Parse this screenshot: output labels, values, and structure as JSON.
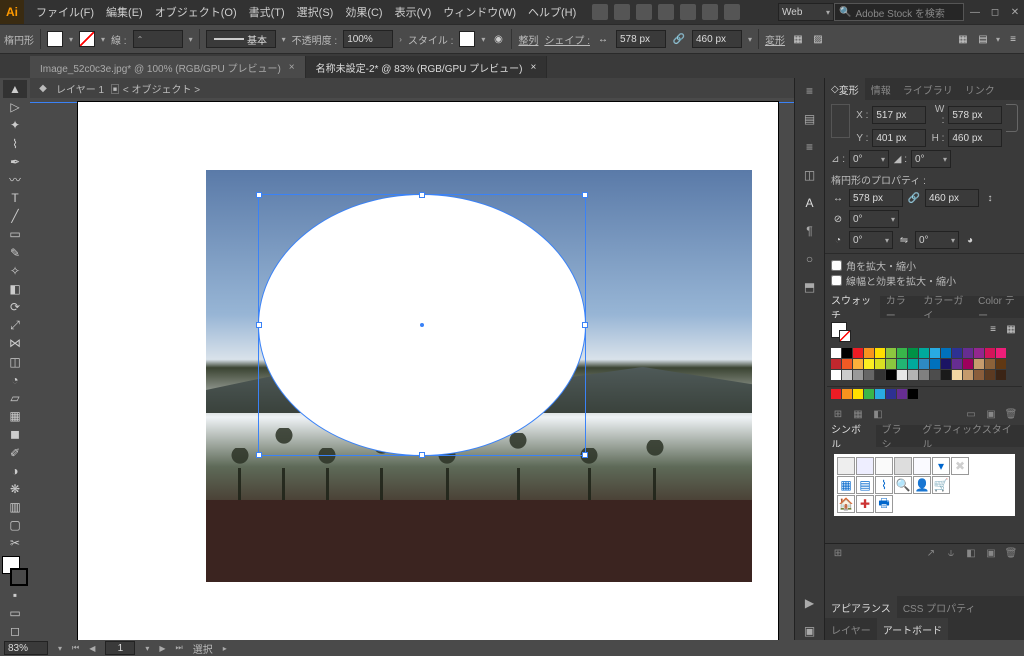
{
  "menu": {
    "items": [
      "ファイル(F)",
      "編集(E)",
      "オブジェクト(O)",
      "書式(T)",
      "選択(S)",
      "効果(C)",
      "表示(V)",
      "ウィンドウ(W)",
      "ヘルプ(H)"
    ]
  },
  "header": {
    "workspace": "Web",
    "search_placeholder": "Adobe Stock を検索"
  },
  "control": {
    "shape_label": "楕円形",
    "stroke_label": "線 :",
    "stroke_profile": "基本",
    "opacity_label": "不透明度 :",
    "opacity": "100%",
    "style_label": "スタイル :",
    "align_label": "整列",
    "shape_btn": "シェイプ :",
    "w": "578 px",
    "h": "460 px",
    "transform_label": "変形"
  },
  "tabs": [
    {
      "label": "Image_52c0c3e.jpg* @ 100% (RGB/GPU プレビュー)",
      "active": false
    },
    {
      "label": "名称未設定-2* @ 83% (RGB/GPU プレビュー)",
      "active": true
    }
  ],
  "breadcrumb": {
    "layer": "レイヤー 1",
    "object": "< オブジェクト >"
  },
  "transform": {
    "tab_transform": "変形",
    "tab_info": "情報",
    "tab_library": "ライブラリ",
    "tab_link": "リンク",
    "x": "517 px",
    "y": "401 px",
    "w": "578 px",
    "h": "460 px",
    "angle": "0°",
    "shear": "0°",
    "section": "楕円形のプロパティ :",
    "pw": "578 px",
    "ph": "460 px",
    "pie_start": "0°",
    "pie_end": "0°",
    "corner": "0°",
    "chk_scale_corners": "角を拡大・縮小",
    "chk_scale_strokes": "線幅と効果を拡大・縮小"
  },
  "swatches": {
    "tabs": [
      "スウォッチ",
      "カラー",
      "カラーガイ",
      "Color テー"
    ]
  },
  "symbols": {
    "tabs": [
      "シンボル",
      "ブラシ",
      "グラフィックスタイル"
    ]
  },
  "appearance": {
    "tabs": [
      "アピアランス",
      "CSS プロパティ"
    ]
  },
  "layers": {
    "tabs": [
      "レイヤー",
      "アートボード"
    ]
  },
  "status": {
    "zoom": "83%",
    "page": "1",
    "tool": "選択"
  },
  "swatch_colors": [
    "#ffffff",
    "#000000",
    "#ed1c24",
    "#f7931e",
    "#ffde00",
    "#8cc63f",
    "#39b54a",
    "#009245",
    "#00a99d",
    "#29abe2",
    "#0071bc",
    "#2e3192",
    "#662d91",
    "#93278f",
    "#d4145a",
    "#ed1e79",
    "#c1272d",
    "#f15a24",
    "#fbb03b",
    "#fcee21",
    "#d9e021",
    "#8cc63f",
    "#22b573",
    "#00a99d",
    "#2e89c2",
    "#0071bc",
    "#1b1464",
    "#662d91",
    "#9e005d",
    "#c69c6d",
    "#8c6239",
    "#603813",
    "#ffffff",
    "#cccccc",
    "#999999",
    "#666666",
    "#333333",
    "#000000",
    "#e6e6e6",
    "#b3b3b3",
    "#808080",
    "#4d4d4d",
    "#1a1a1a",
    "#f2d6a2",
    "#c49a6c",
    "#8a5d3b",
    "#5c3a21",
    "#3b2415"
  ],
  "accent_colors": [
    "#ed1c24",
    "#f7931e",
    "#ffde00",
    "#39b54a",
    "#29abe2",
    "#2e3192",
    "#662d91",
    "#000000"
  ]
}
